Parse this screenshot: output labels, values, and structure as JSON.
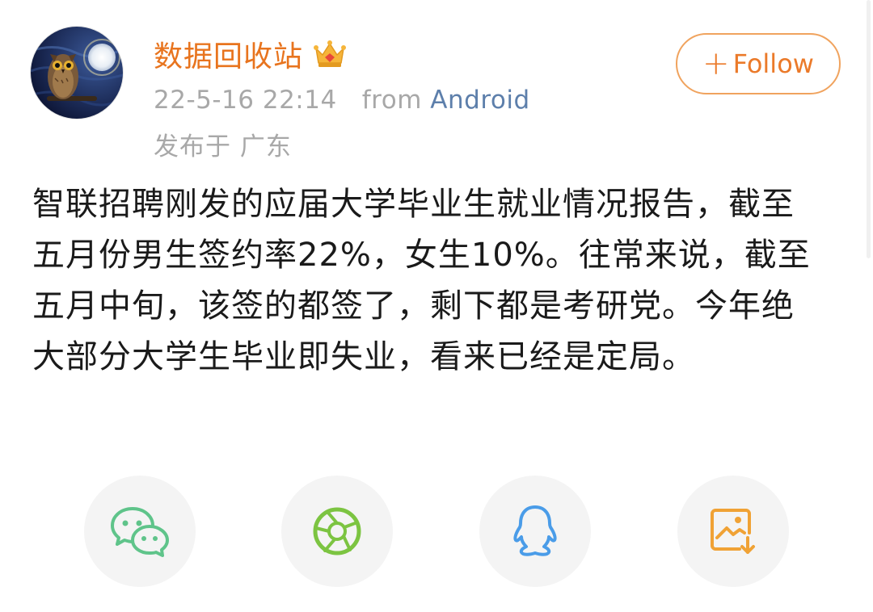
{
  "post": {
    "username": "数据回收站",
    "badge_icon": "crown-icon",
    "timestamp": "22-5-16 22:14",
    "from_label": "from",
    "source": "Android",
    "location": "发布于 广东",
    "follow_plus": "+",
    "follow_label": "Follow",
    "content": "智联招聘刚发的应届大学毕业生就业情况报告，截至五月份男生签约率22%，女生10%。往常来说，截至五月中旬，该签的都签了，剩下都是考研党。今年绝大部分大学生毕业即失业，看来已经是定局。"
  },
  "share": [
    {
      "icon": "wechat-icon",
      "color": "#5fc48a"
    },
    {
      "icon": "moments-icon",
      "color": "#7cc441"
    },
    {
      "icon": "qq-icon",
      "color": "#4a9ce8"
    },
    {
      "icon": "save-image-icon",
      "color": "#f0a235"
    }
  ],
  "colors": {
    "username": "#e8741e",
    "follow_border": "#f0a35e",
    "meta_text": "#a8a8a8",
    "source_link": "#5d7fab",
    "content_text": "#1a1a1a",
    "share_bg": "#f4f4f4"
  }
}
